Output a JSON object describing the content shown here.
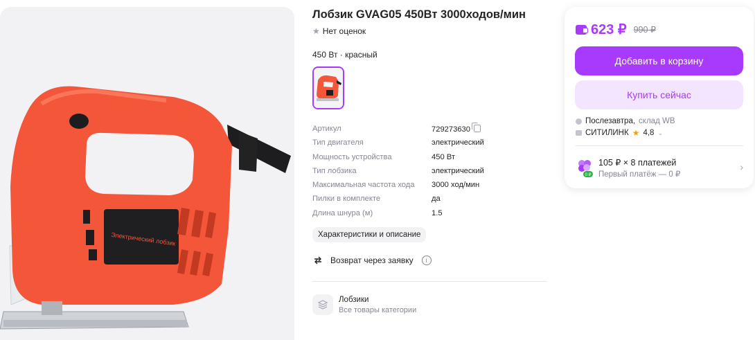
{
  "product": {
    "title": "Лобзик GVAG05 450Вт 3000ходов/мин",
    "rating_text": "Нет оценок",
    "variant": "450 Вт · красный",
    "image_label": "Электрический лобзик"
  },
  "specs": [
    {
      "name": "Артикул",
      "value": "729273630"
    },
    {
      "name": "Тип двигателя",
      "value": "электрический"
    },
    {
      "name": "Мощность устройства",
      "value": "450 Вт"
    },
    {
      "name": "Тип лобзика",
      "value": "электрический"
    },
    {
      "name": "Максимальная частота хода",
      "value": "3000 ход/мин"
    },
    {
      "name": "Пилки в комплекте",
      "value": "да"
    },
    {
      "name": "Длина шнура (м)",
      "value": "1.5"
    }
  ],
  "specs_link": "Характеристики и описание",
  "return_text": "Возврат через заявку",
  "category": {
    "title": "Лобзики",
    "subtitle": "Все товары категории"
  },
  "buybox": {
    "price": "623 ₽",
    "old_price": "990 ₽",
    "add_to_cart": "Добавить в корзину",
    "buy_now": "Купить сейчас",
    "delivery_day": "Послезавтра,",
    "delivery_warehouse": "склад WB",
    "seller": "СИТИЛИНК",
    "seller_rating": "4,8",
    "installment_main": "105 ₽ × 8 платежей",
    "installment_sub": "Первый платёж — 0 ₽",
    "installment_badge": "0 ₽"
  },
  "colors": {
    "accent": "#a73afd",
    "accent_light": "#f3e4ff",
    "muted": "#868695",
    "product_red": "#f4563a"
  }
}
